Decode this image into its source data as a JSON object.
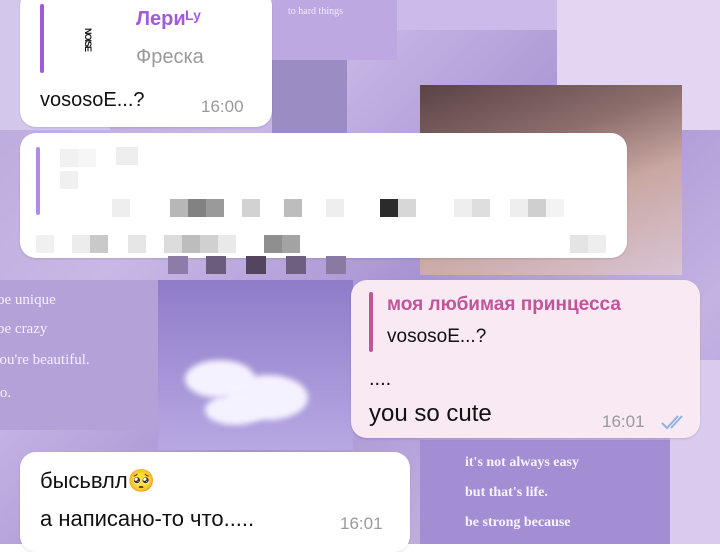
{
  "wallpaper": {
    "quote_left": [
      "be unique",
      "be crazy",
      "you're beautiful.",
      "so."
    ],
    "quote_right": [
      "it's not always easy",
      "but that's life.",
      "be strong because"
    ],
    "top_caption": "to hard things"
  },
  "messages": [
    {
      "reply_author": "Лериᴸʸ",
      "reply_subtitle": "Фреска",
      "reply_sticker": "NOISE",
      "text": "vososoE...?",
      "time": "16:00"
    },
    {
      "text": "",
      "note": "pixelated"
    },
    {
      "reply_author": "моя любимая принцесса",
      "reply_text": "vososoE...?",
      "line1": "....",
      "line2": "you so cute",
      "time": "16:01",
      "status": "read"
    },
    {
      "line1": "бысьвлл🥺",
      "line2": "а написано-то что.....",
      "time": "16:01"
    }
  ],
  "colors": {
    "accent": "#a35ad9",
    "reply_out": "#c2559a",
    "check": "#8fb3e3"
  }
}
